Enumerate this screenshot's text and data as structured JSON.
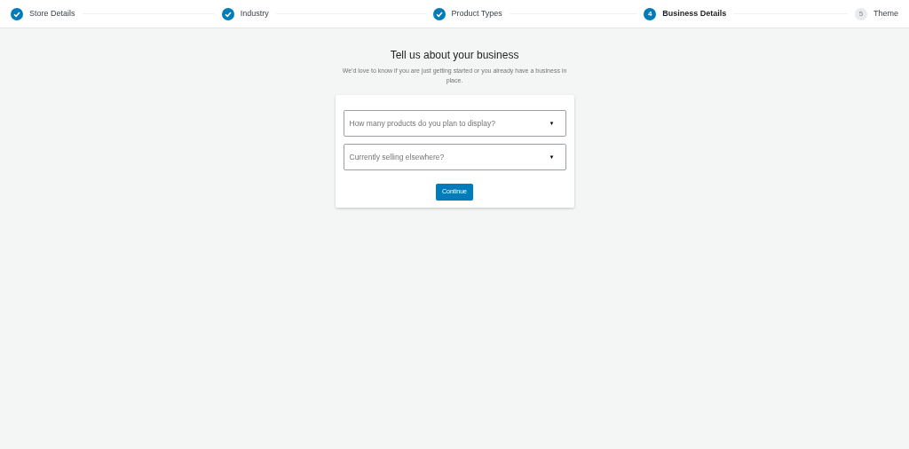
{
  "steps": [
    {
      "label": "Store Details",
      "kind": "done"
    },
    {
      "label": "Industry",
      "kind": "done"
    },
    {
      "label": "Product Types",
      "kind": "done"
    },
    {
      "label": "Business Details",
      "kind": "current",
      "number": "4"
    },
    {
      "label": "Theme",
      "kind": "upcoming",
      "number": "5"
    }
  ],
  "heading": "Tell us about your business",
  "subheading": "We'd love to know if you are just getting started or you already have a business in place.",
  "fields": [
    {
      "placeholder": "How many products do you plan to display?",
      "arrow": "▼"
    },
    {
      "placeholder": "Currently selling elsewhere?",
      "arrow": "▼"
    }
  ],
  "button": "Continue"
}
